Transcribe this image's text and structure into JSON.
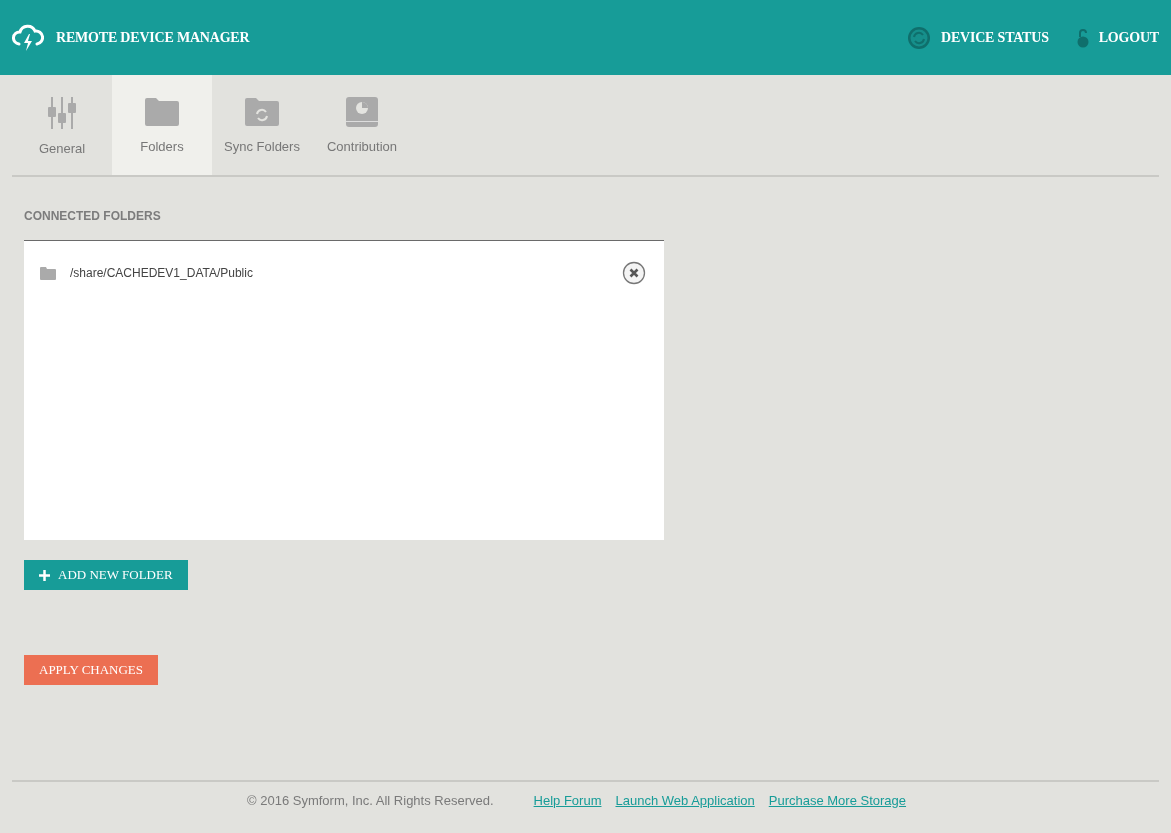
{
  "header": {
    "title": "REMOTE DEVICE MANAGER",
    "actions": [
      {
        "kind": "status",
        "label": "DEVICE STATUS"
      },
      {
        "kind": "logout",
        "label": "LOGOUT"
      }
    ]
  },
  "tabs": [
    {
      "kind": "general",
      "label": "General",
      "selected": false
    },
    {
      "kind": "folders",
      "label": "Folders",
      "selected": true
    },
    {
      "kind": "sync",
      "label": "Sync Folders",
      "selected": false
    },
    {
      "kind": "contribution",
      "label": "Contribution",
      "selected": false
    }
  ],
  "section": {
    "heading": "CONNECTED FOLDERS",
    "folders": [
      {
        "path": "/share/CACHEDEV1_DATA/Public"
      }
    ]
  },
  "buttons": [
    {
      "kind": "add",
      "label": "ADD NEW FOLDER"
    },
    {
      "kind": "apply",
      "label": "APPLY CHANGES"
    }
  ],
  "footer": {
    "copyright": "© 2016 Symform, Inc. All Rights Reserved.",
    "links": [
      "Help Forum",
      "Launch Web Application",
      "Purchase More Storage"
    ]
  }
}
